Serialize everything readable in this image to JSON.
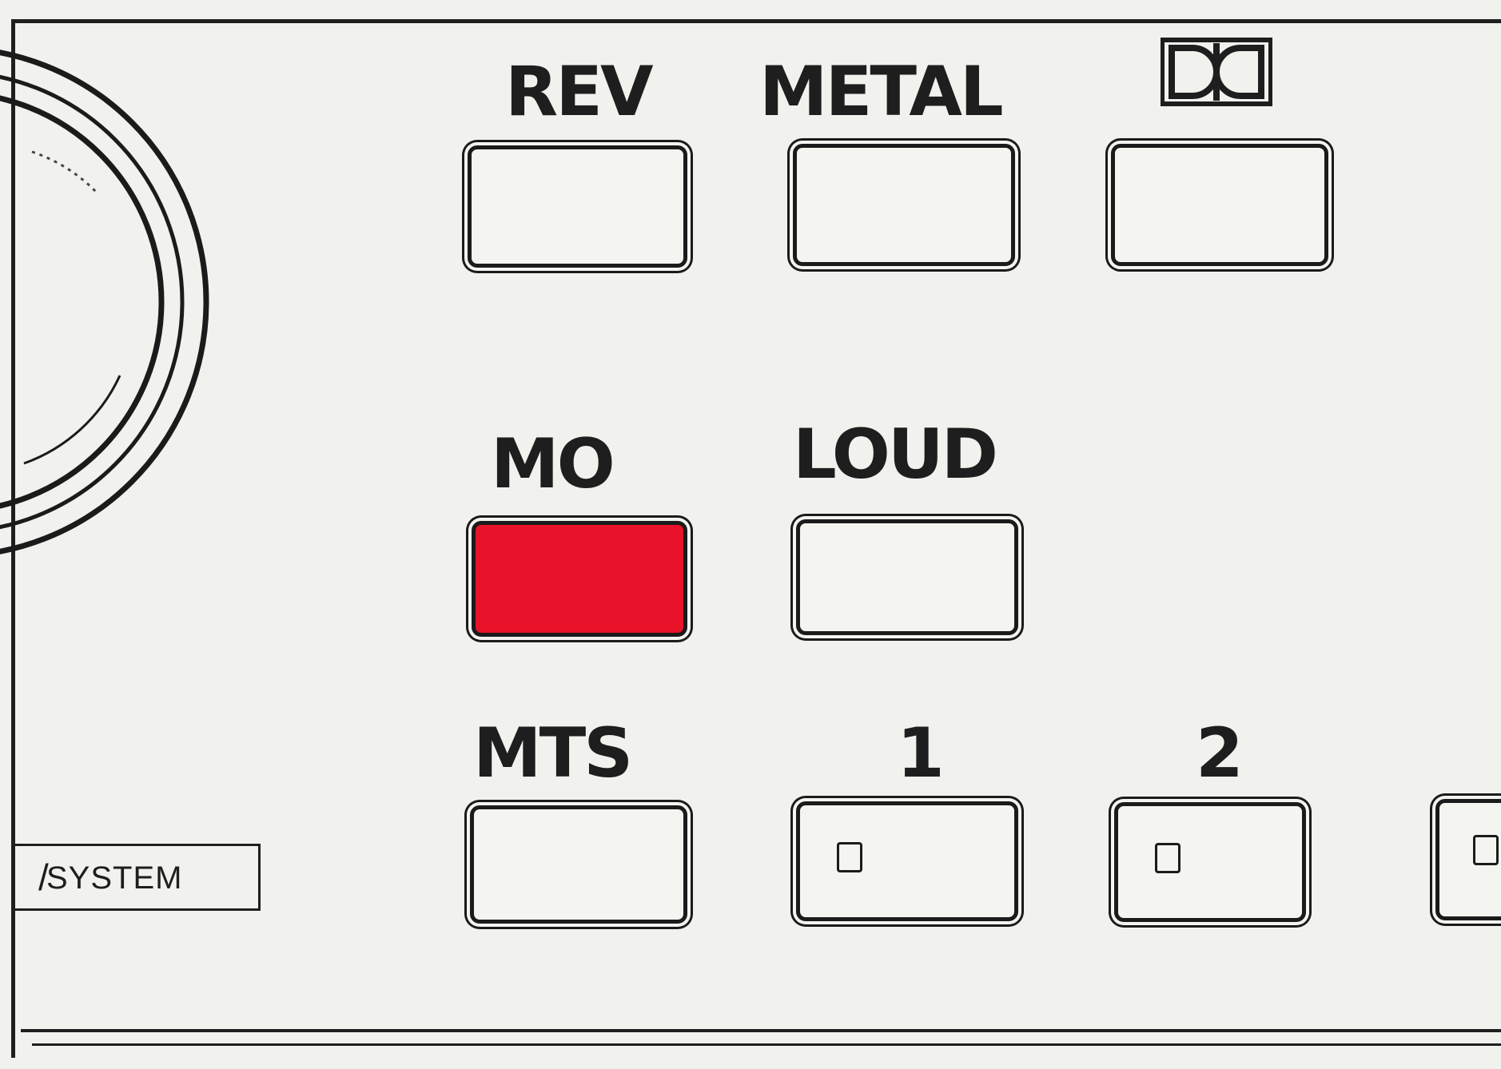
{
  "buttons": {
    "rev": {
      "label": "REV",
      "lit": false
    },
    "metal": {
      "label": "METAL",
      "lit": false
    },
    "dolby": {
      "label_icon": "dolby-double-d-icon",
      "lit": false
    },
    "mo": {
      "label": "MO",
      "lit": true
    },
    "loud": {
      "label": "LOUD",
      "lit": false
    },
    "mts": {
      "label": "MTS",
      "lit": false
    },
    "channel_1": {
      "label": "1",
      "lit": false
    },
    "channel_2": {
      "label": "2",
      "lit": false
    }
  },
  "system_box": {
    "label": "SYSTEM"
  },
  "colors": {
    "lit_button": "#e8132a",
    "ink": "#1b1b1b",
    "panel": "#f1f1ee"
  }
}
